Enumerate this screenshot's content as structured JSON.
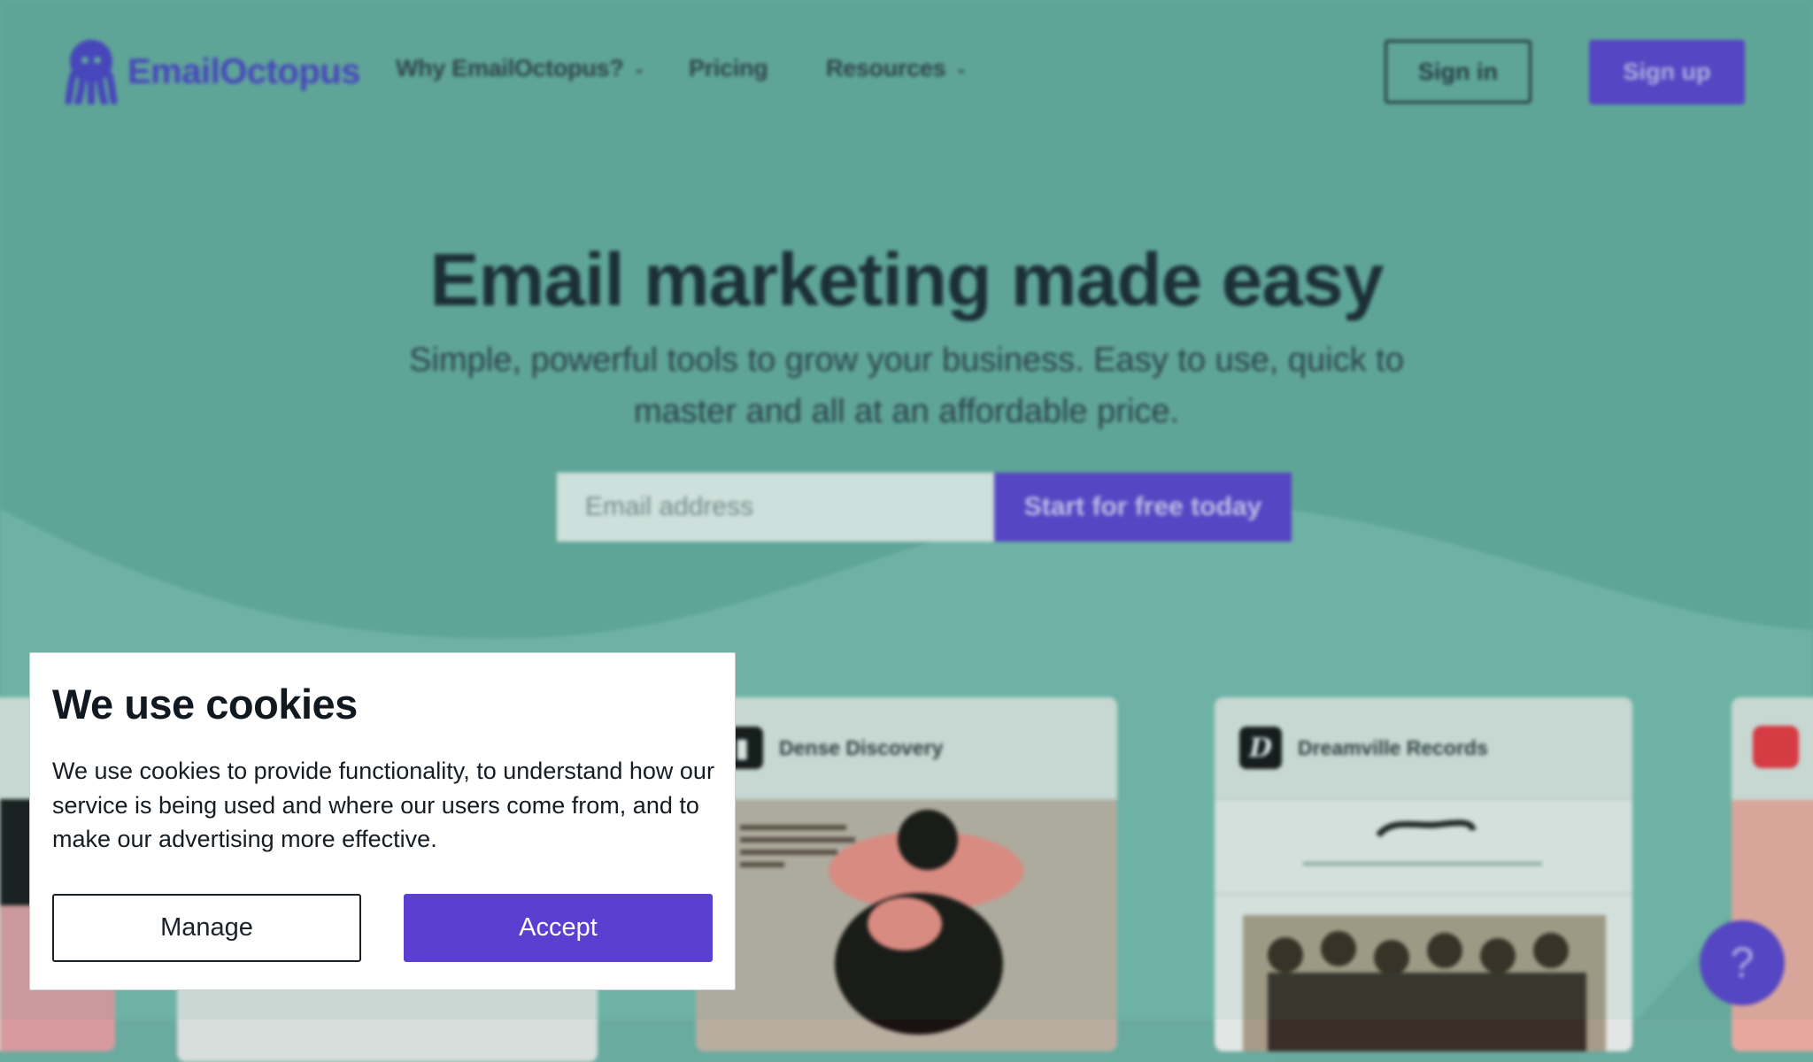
{
  "nav": {
    "brand": "EmailOctopus",
    "links": [
      {
        "label": "Why EmailOctopus?"
      },
      {
        "label": "Pricing"
      },
      {
        "label": "Resources"
      }
    ],
    "sign_in": "Sign in",
    "sign_up": "Sign up"
  },
  "hero": {
    "title": "Email marketing made easy",
    "subtitle": "Simple, powerful tools to grow your business. Easy to use, quick to master and all at an affordable price.",
    "email_placeholder": "Email address",
    "cta": "Start for free today"
  },
  "cards": [
    {
      "name": "Dense Discovery",
      "icon": "dense-discovery-logo"
    },
    {
      "name": "Dreamville Records",
      "icon": "dreamville-logo"
    }
  ],
  "help": {
    "label": "?"
  },
  "cookie": {
    "title": "We use cookies",
    "body": "We use cookies to provide functionality, to understand how our service is being used and where our users come from, and to make our advertising more effective.",
    "manage": "Manage",
    "accept": "Accept"
  },
  "colors": {
    "brand": "#5a3fc9",
    "background": "#6aab9f",
    "dialog": "#ffffff"
  }
}
